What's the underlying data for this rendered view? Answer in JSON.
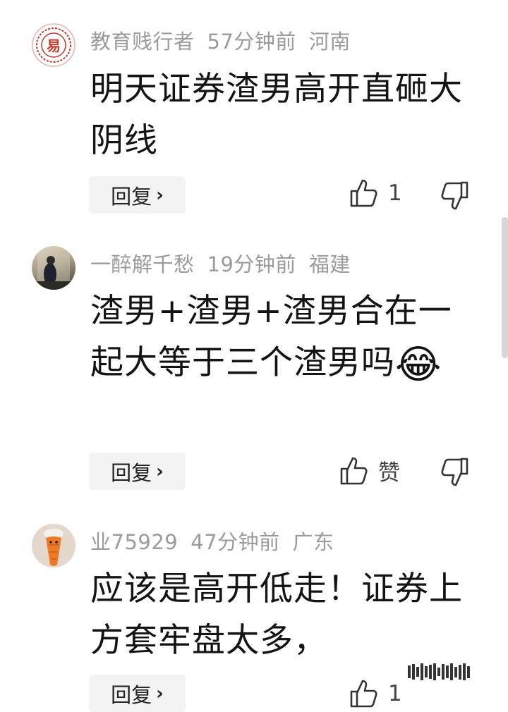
{
  "comments": [
    {
      "username": "教育贱行者",
      "time": "57分钟前",
      "location": "河南",
      "avatar_icon": "seal-logo-avatar",
      "avatar_glyph": "易",
      "text": "明天证券渣男高开直砸大阴线",
      "reply_label": "回复",
      "like_label": "1"
    },
    {
      "username": "一醉解千愁",
      "time": "19分钟前",
      "location": "福建",
      "avatar_icon": "photo-avatar",
      "text": "渣男+渣男+渣男合在一起大等于三个渣男吗",
      "emoji": "😂",
      "reply_label": "回复",
      "like_label": "赞"
    },
    {
      "username": "业75929",
      "time": "47分钟前",
      "location": "广东",
      "avatar_icon": "carrot-avatar",
      "text": "应该是高开低走！证券上方套牢盘太多，",
      "reply_label": "回复",
      "like_label": "1"
    }
  ],
  "colors": {
    "meta": "#9b9b9b",
    "reply_bg": "#f3f3f3",
    "seal_red": "#c0392b"
  }
}
